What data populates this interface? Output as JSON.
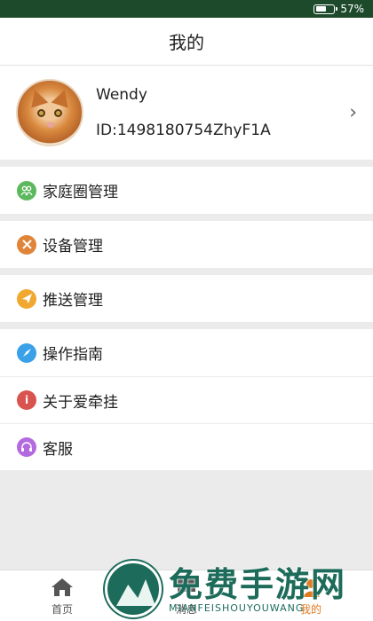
{
  "status_bar": {
    "battery_text": "57%",
    "battery_level": 0.57
  },
  "header": {
    "title": "我的"
  },
  "profile": {
    "name": "Wendy",
    "id": "ID:1498180754ZhyF1A"
  },
  "menu": [
    {
      "label": "家庭圈管理",
      "icon": "family-icon",
      "color": "#5cb85c"
    },
    {
      "label": "设备管理",
      "icon": "tools-icon",
      "color": "#e0843a"
    },
    {
      "label": "推送管理",
      "icon": "send-icon",
      "color": "#f0a830"
    },
    {
      "label": "操作指南",
      "icon": "compass-icon",
      "color": "#3aa0e8"
    },
    {
      "label": "关于爱牵挂",
      "icon": "info-icon",
      "color": "#d9534f"
    },
    {
      "label": "客服",
      "icon": "headset-icon",
      "color": "#b46adf"
    }
  ],
  "tabs": [
    {
      "label": "首页",
      "icon": "home-icon"
    },
    {
      "label": "消息",
      "icon": "message-icon"
    },
    {
      "label": "我的",
      "icon": "user-icon",
      "active": true
    }
  ],
  "watermark": {
    "cn": "免费手游网",
    "en": "MIANFEISHOUYOUWANG"
  }
}
